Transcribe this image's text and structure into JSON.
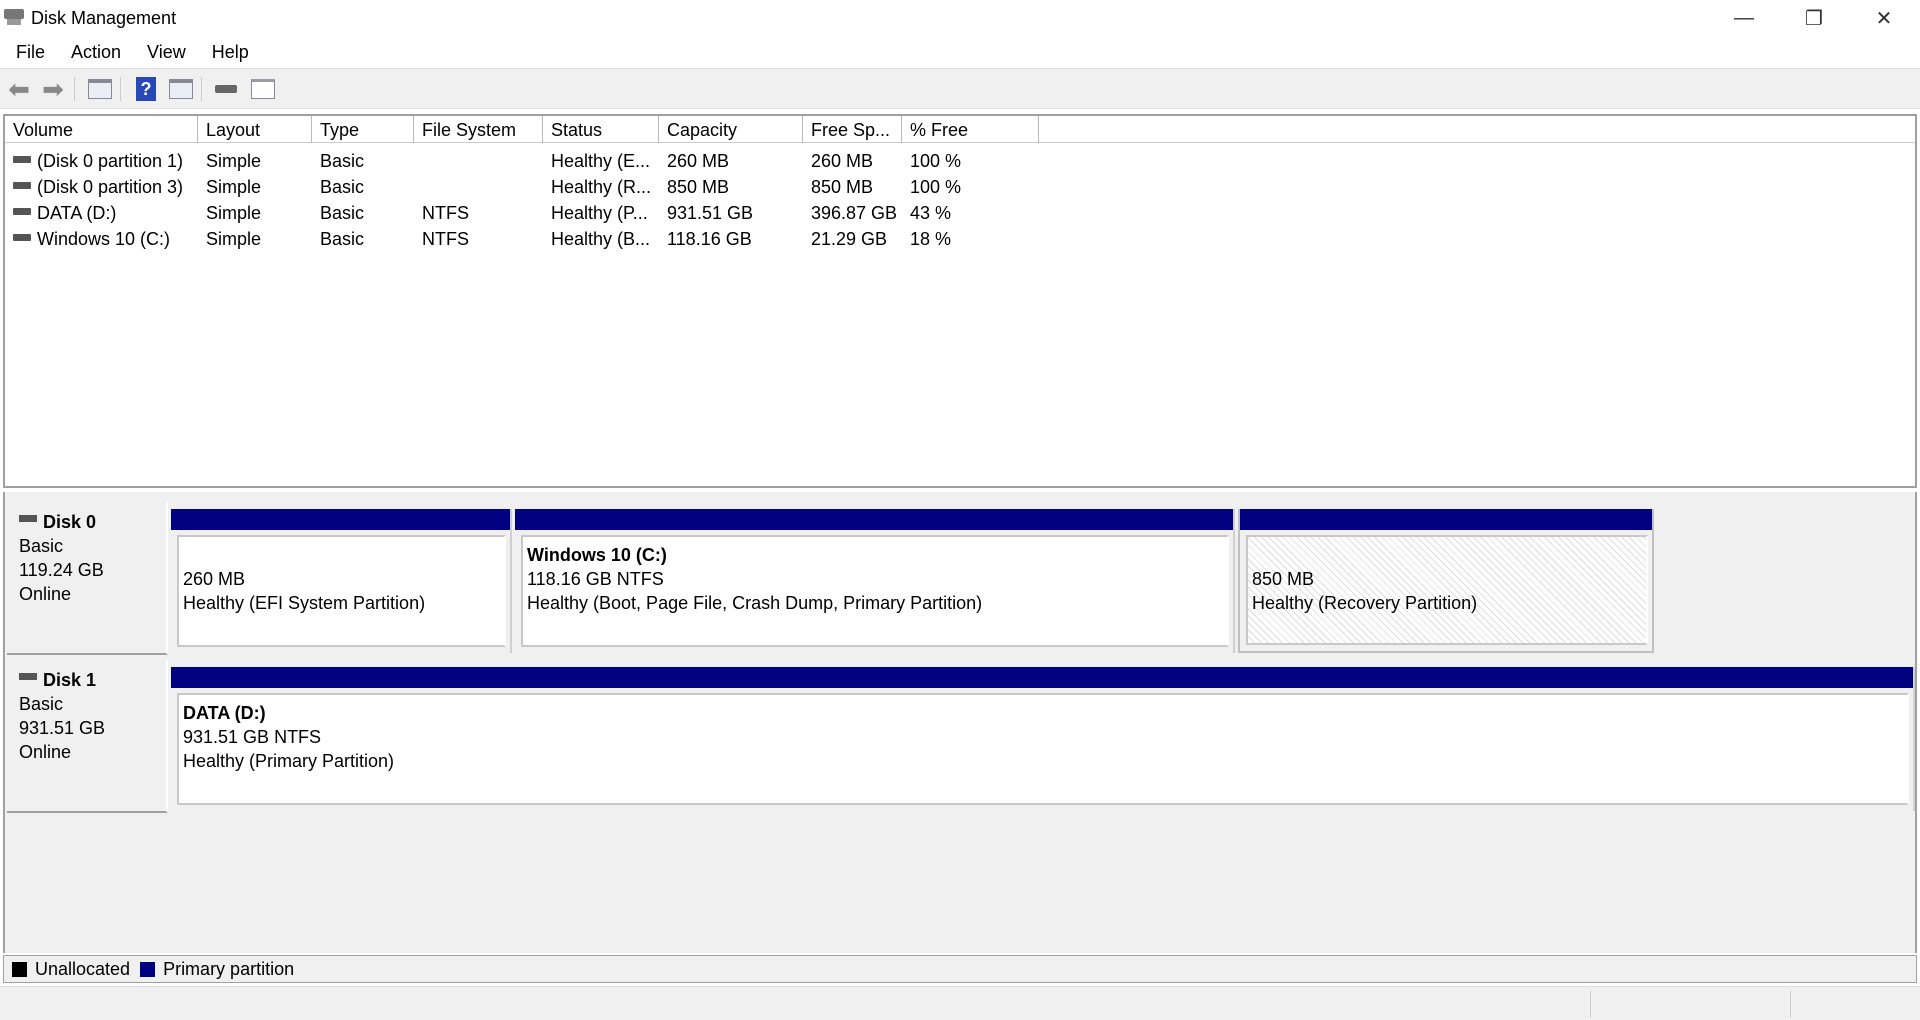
{
  "window": {
    "title": "Disk Management",
    "minimize": "—",
    "restore": "❐",
    "close": "✕"
  },
  "menu": [
    "File",
    "Action",
    "View",
    "Help"
  ],
  "toolbar": [
    "back",
    "forward",
    "show-hide-console-tree",
    "help",
    "show-hide-action-pane",
    "connect",
    "properties"
  ],
  "columns": [
    "Volume",
    "Layout",
    "Type",
    "File System",
    "Status",
    "Capacity",
    "Free Sp...",
    "% Free"
  ],
  "volumes": [
    [
      "(Disk 0 partition 1)",
      "Simple",
      "Basic",
      "",
      "Healthy (E...",
      "260 MB",
      "260 MB",
      "100 %"
    ],
    [
      "(Disk 0 partition 3)",
      "Simple",
      "Basic",
      "",
      "Healthy (R...",
      "850 MB",
      "850 MB",
      "100 %"
    ],
    [
      "DATA (D:)",
      "Simple",
      "Basic",
      "NTFS",
      "Healthy (P...",
      "931.51 GB",
      "396.87 GB",
      "43 %"
    ],
    [
      "Windows 10 (C:)",
      "Simple",
      "Basic",
      "NTFS",
      "Healthy (B...",
      "118.16 GB",
      "21.29 GB",
      "18 %"
    ]
  ],
  "disks": [
    {
      "name": "Disk 0",
      "type": "Basic",
      "size": "119.24 GB",
      "state": "Online",
      "partitions": [
        {
          "title": "",
          "line1": "260 MB",
          "line2": "Healthy (EFI System Partition)"
        },
        {
          "title": "Windows 10  (C:)",
          "line1": "118.16 GB NTFS",
          "line2": "Healthy (Boot, Page File, Crash Dump, Primary Partition)"
        },
        {
          "title": "",
          "line1": "850 MB",
          "line2": "Healthy (Recovery Partition)"
        }
      ]
    },
    {
      "name": "Disk 1",
      "type": "Basic",
      "size": "931.51 GB",
      "state": "Online",
      "partitions": [
        {
          "title": "DATA  (D:)",
          "line1": "931.51 GB NTFS",
          "line2": "Healthy (Primary Partition)"
        }
      ]
    }
  ],
  "legend": [
    {
      "label": "Unallocated",
      "color": "#000000"
    },
    {
      "label": "Primary partition",
      "color": "#000080"
    }
  ]
}
